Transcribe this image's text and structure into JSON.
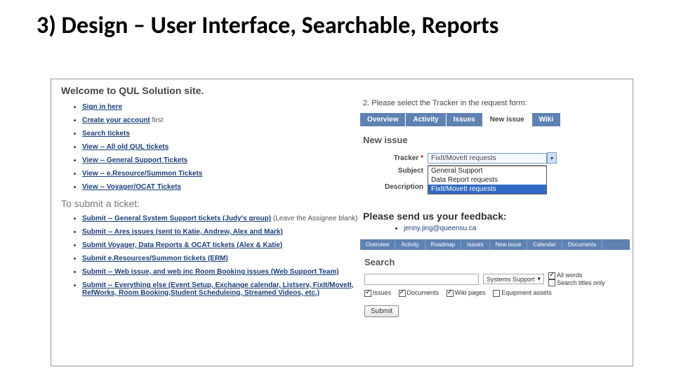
{
  "slide": {
    "title": "3) Design – User Interface, Searchable, Reports"
  },
  "left": {
    "welcome": "Welcome to QUL Solution site.",
    "nav": [
      {
        "label": "Sign in here",
        "tail": ""
      },
      {
        "label": "Create your account",
        "tail": " first"
      },
      {
        "label": "Search tickets",
        "tail": ""
      },
      {
        "label": "View -- All old QUL tickets",
        "tail": ""
      },
      {
        "label": "View -- General Support Tickets",
        "tail": ""
      },
      {
        "label": "View -- e.Resource/Summon Tickets",
        "tail": ""
      },
      {
        "label": "View -- Voyager/OCAT Tickets",
        "tail": ""
      }
    ],
    "submit_heading": "To submit a ticket:",
    "submit": [
      {
        "label": "Submit -- General System Support tickets (Judy's group)",
        "tail": " (Leave the Assignee blank)"
      },
      {
        "label": "Submit -- Ares issues (sent to Katie, Andrew, Alex and Mark)",
        "tail": ""
      },
      {
        "label": "Submit      Voyager, Data Reports & OCAT tickets (Alex & Katie)",
        "tail": ""
      },
      {
        "label": "Submit      e.Resources/Summon tickets (ERM)",
        "tail": ""
      },
      {
        "label": "Submit -- Web issue, and web inc Room Booking issues (Web Support Team)",
        "tail": ""
      },
      {
        "label": "Submit -- Everything else (Event Setup, Exchange calendar, Listserv, FixIt/MoveIt, RefWorks, Room Booking,Student Scheduleing, Streamed Videos, etc.)",
        "tail": ""
      }
    ]
  },
  "right": {
    "step2": "2. Please select the Tracker in the request form:",
    "tabs": [
      "Overview",
      "Activity",
      "Issues",
      "New issue",
      "Wiki"
    ],
    "active_tab": 3,
    "newissue_title": "New issue",
    "form": {
      "tracker_label": "Tracker",
      "tracker_required": "*",
      "tracker_selected": "FixIt/MoveIt requests",
      "tracker_options": [
        "General Support",
        "Data Report requests",
        "FixIt/MoveIt requests"
      ],
      "subject_label": "Subject",
      "description_label": "Description"
    },
    "feedback_heading": "Please send us your feedback:",
    "feedback_email": "jenny.jing@queensu.ca",
    "tabs2": [
      "Overview",
      "Activity",
      "Roadmap",
      "Issues",
      "New issue",
      "Calendar",
      "Documents"
    ],
    "search_heading": "Search",
    "search_scope": "Systems Support",
    "opt_all_words": "All words",
    "opt_titles_only": "Search titles only",
    "check_issues": "Issues",
    "check_documents": "Documents",
    "check_wiki": "Wiki pages",
    "check_equipment": "Equipment assets",
    "submit_btn": "Submit"
  }
}
